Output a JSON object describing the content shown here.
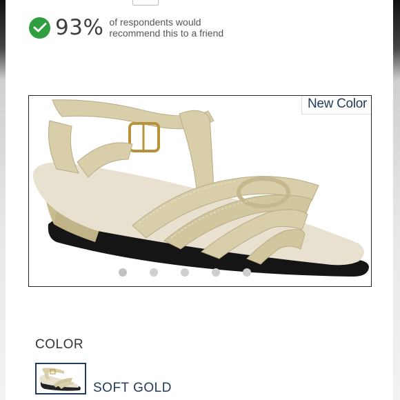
{
  "recommendation": {
    "percent": "93%",
    "line1": "of respondents would",
    "line2": "recommend this to a friend"
  },
  "carousel": {
    "badge": "New Color",
    "slide_count": 5,
    "active_slide": 1
  },
  "color_selector": {
    "heading": "COLOR",
    "selected_name": "SOFT GOLD"
  },
  "colors": {
    "check_green": "#2e9e3e",
    "accent_navy": "#1f3a5a",
    "sandal_gold": "#d9ceaa"
  },
  "icons": {
    "checkmark": "check-icon"
  }
}
